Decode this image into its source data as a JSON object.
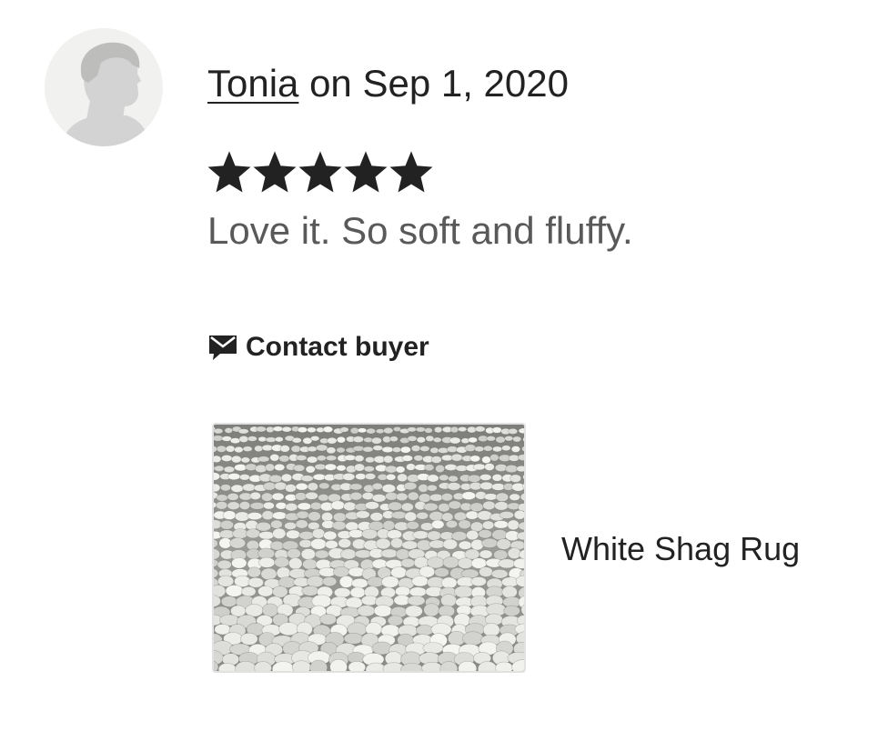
{
  "review": {
    "reviewer_name": "Tonia",
    "date_text": " on Sep 1, 2020",
    "rating": 5,
    "rating_max": 5,
    "text": "Love it. So soft and fluffy.",
    "avatar_icon": "default-user-silhouette-icon"
  },
  "contact": {
    "label": "Contact buyer",
    "icon": "message-icon"
  },
  "product": {
    "title": "White Shag Rug",
    "thumbnail": "shag-rug-texture"
  },
  "colors": {
    "text_primary": "#222222",
    "text_secondary": "#595959",
    "avatar_bg": "#f1f1ef",
    "avatar_silhouette": "#d6d6d6",
    "star": "#222222"
  }
}
